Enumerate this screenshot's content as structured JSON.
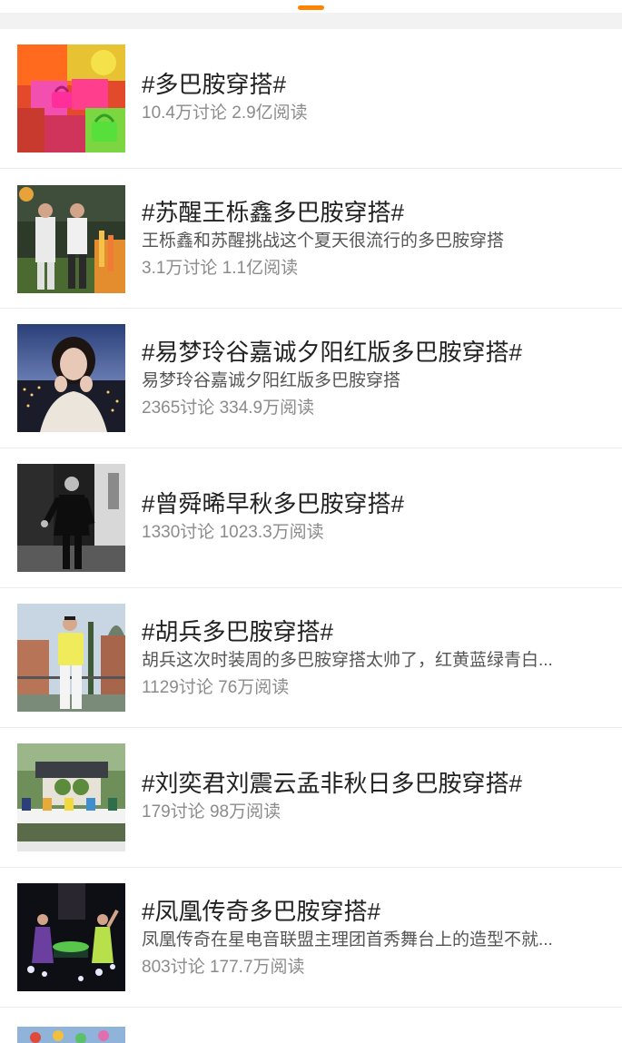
{
  "feed": {
    "items": [
      {
        "title": "#多巴胺穿搭#",
        "desc": "",
        "discussions": "10.4万讨论",
        "reads": "2.9亿阅读",
        "thumb": "colorful-bags-thumbnail"
      },
      {
        "title": "#苏醒王栎鑫多巴胺穿搭#",
        "desc": "王栎鑫和苏醒挑战这个夏天很流行的多巴胺穿搭",
        "discussions": "3.1万讨论",
        "reads": "1.1亿阅读",
        "thumb": "two-men-garden-thumbnail"
      },
      {
        "title": "#易梦玲谷嘉诚夕阳红版多巴胺穿搭#",
        "desc": "易梦玲谷嘉诚夕阳红版多巴胺穿搭",
        "discussions": "2365讨论",
        "reads": "334.9万阅读",
        "thumb": "woman-city-night-thumbnail"
      },
      {
        "title": "#曾舜晞早秋多巴胺穿搭#",
        "desc": "",
        "discussions": "1330讨论",
        "reads": "1023.3万阅读",
        "thumb": "man-black-white-thumbnail"
      },
      {
        "title": "#胡兵多巴胺穿搭#",
        "desc": "胡兵这次时装周的多巴胺穿搭太帅了，红黄蓝绿青白...",
        "discussions": "1129讨论",
        "reads": "76万阅读",
        "thumb": "man-yellow-outfit-thumbnail"
      },
      {
        "title": "#刘奕君刘震云孟非秋日多巴胺穿搭#",
        "desc": "",
        "discussions": "179讨论",
        "reads": "98万阅读",
        "thumb": "outdoor-panel-thumbnail"
      },
      {
        "title": "#凤凰传奇多巴胺穿搭#",
        "desc": "凤凰传奇在星电音联盟主理团首秀舞台上的造型不就...",
        "discussions": "803讨论",
        "reads": "177.7万阅读",
        "thumb": "stage-performance-thumbnail"
      }
    ]
  },
  "colors": {
    "accent": "#ff8200",
    "title": "#222222",
    "meta": "#8b8b8b"
  }
}
